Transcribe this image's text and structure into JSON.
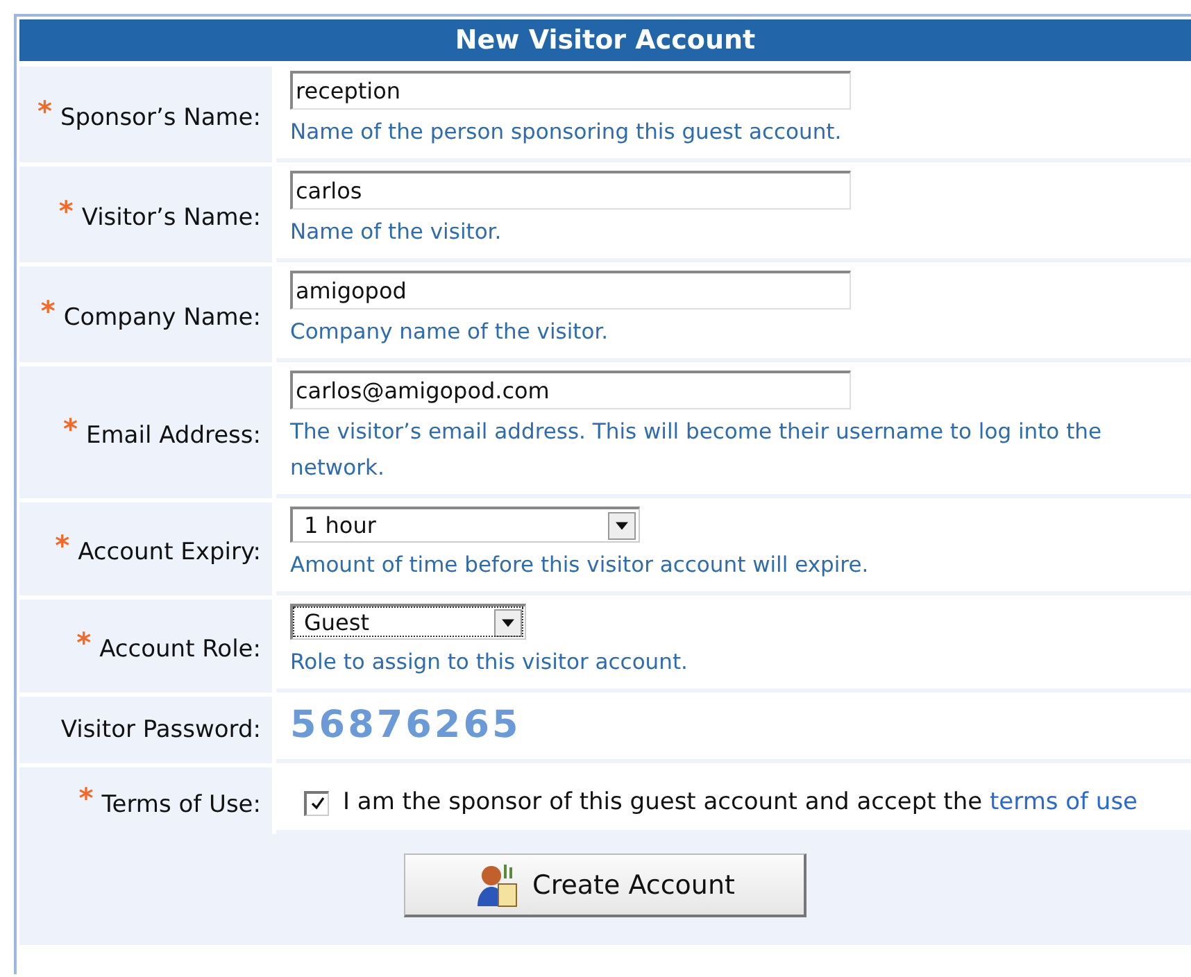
{
  "form": {
    "title": "New Visitor Account",
    "fields": [
      {
        "kind": "text",
        "marker": "*",
        "label": "Sponsor’s Name:",
        "value": "reception",
        "hint": "Name of the person sponsoring this guest account."
      },
      {
        "kind": "text",
        "marker": "*",
        "label": "Visitor’s Name:",
        "value": "carlos",
        "hint": "Name of the visitor."
      },
      {
        "kind": "text",
        "marker": "*",
        "label": "Company Name:",
        "value": "amigopod",
        "hint": "Company name of the visitor."
      },
      {
        "kind": "text",
        "marker": "*",
        "label": "Email Address:",
        "value": "carlos@amigopod.com",
        "hint": "The visitor’s email address. This will become their username to log into the network."
      },
      {
        "kind": "select",
        "marker": "*",
        "label": "Account Expiry:",
        "value": "1 hour",
        "hint": "Amount of time before this visitor account will expire.",
        "compact": false,
        "focused": false
      },
      {
        "kind": "select",
        "marker": "*",
        "label": "Account Role:",
        "value": "Guest",
        "hint": "Role to assign to this visitor account.",
        "compact": true,
        "focused": true
      },
      {
        "kind": "password",
        "label": "Visitor Password:",
        "value": "56876265"
      },
      {
        "kind": "checkbox",
        "marker": "*",
        "label": "Terms of Use:",
        "checked": true,
        "text": "I am the sponsor of this guest account and accept the",
        "link": "terms of use"
      }
    ],
    "submit": "Create Account"
  }
}
